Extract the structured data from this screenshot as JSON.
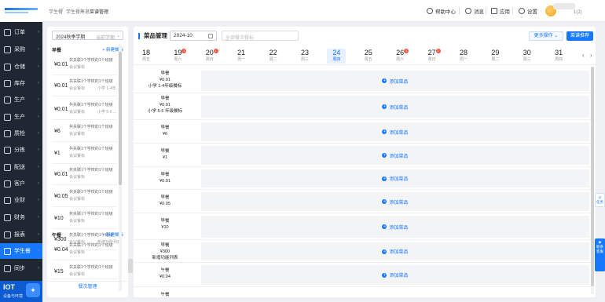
{
  "sidebar": {
    "items": [
      {
        "label": "订单",
        "icon": "order-icon"
      },
      {
        "label": "采购",
        "icon": "purchase-icon"
      },
      {
        "label": "仓储",
        "icon": "warehouse-icon"
      },
      {
        "label": "库存",
        "icon": "inventory-icon"
      },
      {
        "label": "生产",
        "icon": "production-icon"
      },
      {
        "label": "生产",
        "icon": "production-icon"
      },
      {
        "label": "质检",
        "icon": "inspection-icon"
      },
      {
        "label": "分拣",
        "icon": "sorting-icon"
      },
      {
        "label": "配送",
        "icon": "delivery-icon"
      },
      {
        "label": "客户",
        "icon": "customer-icon"
      },
      {
        "label": "业财",
        "icon": "finance-icon"
      },
      {
        "label": "财务",
        "icon": "accounting-icon"
      },
      {
        "label": "报表",
        "icon": "report-icon"
      },
      {
        "label": "学生餐",
        "icon": "student-meal-icon"
      },
      {
        "label": "同步",
        "icon": "sync-icon"
      }
    ],
    "iot_title": "IOT",
    "iot_sub": "设备与环境"
  },
  "breadcrumbs": [
    "学生餐",
    "学生餐筹退",
    "菜谱管理"
  ],
  "topbar": {
    "help": "帮助中心",
    "messages": "消息",
    "apps": "应用",
    "settings": "设置",
    "user_suffix": "1(2)"
  },
  "left_panel": {
    "term": "2024秋季学期",
    "term_placeholder": "当前学期",
    "sections": [
      {
        "name": "早餐",
        "add_label": "+ 新建餐标"
      },
      {
        "name": "午餐",
        "add_label": "+ 新建餐标"
      }
    ],
    "cards": [
      {
        "price": "¥0.01",
        "line1": "共关联1个学校的1个班级",
        "line2": "会议餐标",
        "line3": ""
      },
      {
        "price": "¥0.01",
        "line1": "共关联1个学校的1个班级",
        "line2": "会议餐标",
        "line3": "小学 1-4年..."
      },
      {
        "price": "¥0.01",
        "line1": "共关联1个学校的1个班级",
        "line2": "会议餐标",
        "line3": "小学 5-6 ..."
      },
      {
        "price": "¥6",
        "line1": "共关联1个学校的1个班级",
        "line2": "会议餐标",
        "line3": ""
      },
      {
        "price": "¥1",
        "line1": "共关联1个学校的1个班级",
        "line2": "会议餐标",
        "line3": ""
      },
      {
        "price": "¥0.01",
        "line1": "共关联1个学校的1个班级",
        "line2": "会议餐标",
        "line3": ""
      },
      {
        "price": "¥0.05",
        "line1": "共关联1个学校的1个班级",
        "line2": "会议餐标",
        "line3": ""
      },
      {
        "price": "¥10",
        "line1": "共关联1个学校的1个班级",
        "line2": "会议餐标",
        "line3": ""
      },
      {
        "price": "¥300",
        "line1": "共关联1个学校的1个班级",
        "line2": "会议餐标",
        "line3": "新增功能列表"
      },
      {
        "price": "¥0.04",
        "line1": "共关联1个学校的1个班级",
        "line2": "会议餐标",
        "line3": ""
      },
      {
        "price": "¥15",
        "line1": "共关联1个学校的1个班级",
        "line2": "会议餐标",
        "line3": ""
      }
    ],
    "footer": "餐次管理"
  },
  "right_panel": {
    "title": "菜品管理",
    "month": "2024-10",
    "meal_select_placeholder": "全部餐次餐标",
    "more_label": "更多操作 ⌄",
    "order_label": "菜谱推荐",
    "days": [
      {
        "d": "18",
        "w": "周五",
        "badge": ""
      },
      {
        "d": "19",
        "w": "周六",
        "badge": "1"
      },
      {
        "d": "20",
        "w": "周日",
        "badge": "1"
      },
      {
        "d": "21",
        "w": "周一",
        "badge": ""
      },
      {
        "d": "22",
        "w": "周二",
        "badge": ""
      },
      {
        "d": "23",
        "w": "周三",
        "badge": ""
      },
      {
        "d": "24",
        "w": "周四",
        "badge": ""
      },
      {
        "d": "25",
        "w": "周五",
        "badge": ""
      },
      {
        "d": "26",
        "w": "周六",
        "badge": "1"
      },
      {
        "d": "27",
        "w": "周日",
        "badge": "1"
      },
      {
        "d": "28",
        "w": "周一",
        "badge": ""
      },
      {
        "d": "29",
        "w": "周二",
        "badge": ""
      },
      {
        "d": "30",
        "w": "周三",
        "badge": ""
      },
      {
        "d": "31",
        "w": "周四",
        "badge": ""
      }
    ],
    "selected_day": "24",
    "rows": [
      {
        "meal": "早餐",
        "price": "¥0.01",
        "note": "小学 1-4年级餐标"
      },
      {
        "meal": "早餐",
        "price": "¥0.01",
        "note": "小学 5-6 年级餐标"
      },
      {
        "meal": "早餐",
        "price": "¥6",
        "note": ""
      },
      {
        "meal": "早餐",
        "price": "¥1",
        "note": ""
      },
      {
        "meal": "早餐",
        "price": "¥0.01",
        "note": ""
      },
      {
        "meal": "早餐",
        "price": "¥0.05",
        "note": ""
      },
      {
        "meal": "早餐",
        "price": "¥10",
        "note": ""
      },
      {
        "meal": "早餐",
        "price": "¥300",
        "note": "新增功能列表"
      },
      {
        "meal": "午餐",
        "price": "¥0.04",
        "note": ""
      },
      {
        "meal": "午餐",
        "price": "",
        "note": ""
      }
    ],
    "add_dish": "添加菜品"
  },
  "floating": {
    "btn1": "任务",
    "btn2": "联系客服"
  }
}
